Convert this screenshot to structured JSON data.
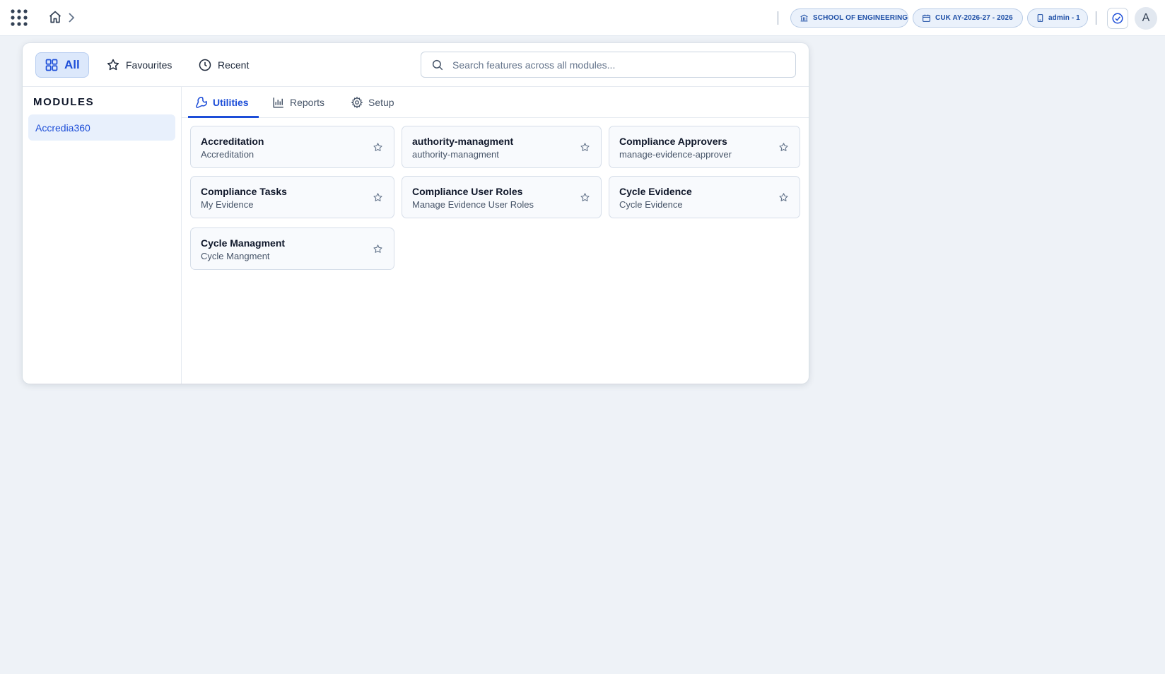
{
  "topbar": {
    "icons": {
      "apps": "apps-grid-icon",
      "home": "home-icon",
      "breadcrumb_separator": "chevron-right-icon"
    },
    "school_label": "SCHOOL OF ENGINEERING",
    "academic_year_label": "CUK AY-2026-27 - 2026",
    "user_label": "admin - 1",
    "avatar_initial": "A"
  },
  "panel": {
    "filters": [
      {
        "label": "All",
        "icon": "grid-icon",
        "active": true
      },
      {
        "label": "Favourites",
        "icon": "star-icon",
        "active": false
      },
      {
        "label": "Recent",
        "icon": "clock-icon",
        "active": false
      }
    ],
    "search": {
      "placeholder": "Search features across all modules...",
      "value": ""
    },
    "modules_heading": "MODULES",
    "modules": [
      {
        "label": "Accredia360",
        "selected": true
      }
    ],
    "tabs": [
      {
        "label": "Utilities",
        "icon": "wrench-icon",
        "active": true
      },
      {
        "label": "Reports",
        "icon": "bar-chart-icon",
        "active": false
      },
      {
        "label": "Setup",
        "icon": "gear-icon",
        "active": false
      }
    ],
    "cards": [
      {
        "title": "Accreditation",
        "subtitle": "Accreditation"
      },
      {
        "title": "authority-managment",
        "subtitle": "authority-managment"
      },
      {
        "title": "Compliance Approvers",
        "subtitle": "manage-evidence-approver"
      },
      {
        "title": "Compliance Tasks",
        "subtitle": "My Evidence"
      },
      {
        "title": "Compliance User Roles",
        "subtitle": "Manage Evidence User Roles"
      },
      {
        "title": "Cycle Evidence",
        "subtitle": "Cycle Evidence"
      },
      {
        "title": "Cycle Managment",
        "subtitle": "Cycle Mangment"
      }
    ]
  },
  "colors": {
    "accent": "#1d4ed8",
    "background": "#eef2f7",
    "card_background": "#f8fafd",
    "pill_background": "#eaf1fb"
  }
}
